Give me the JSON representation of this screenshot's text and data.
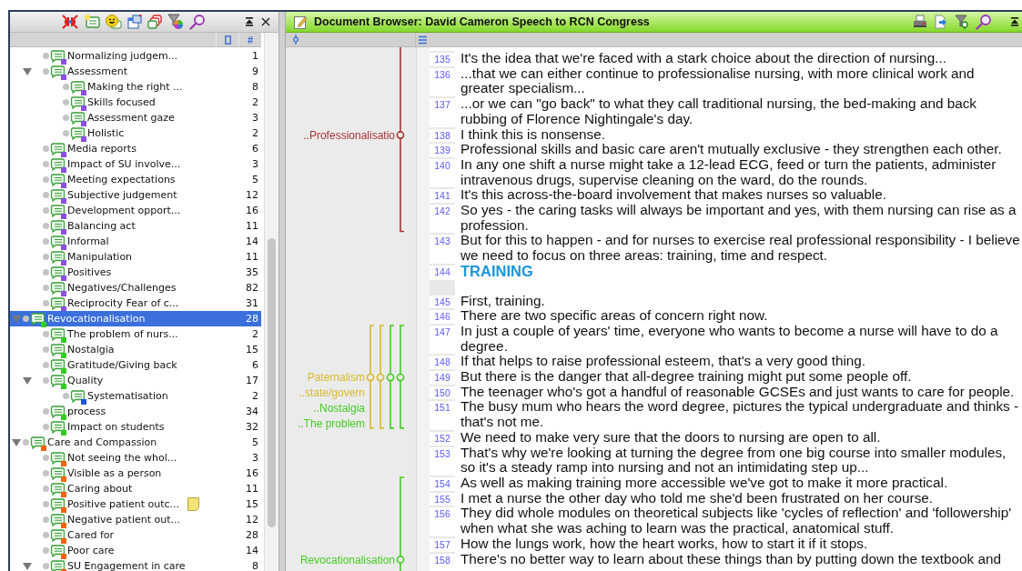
{
  "code_panel": {
    "toolbar": {
      "buttons": [
        {
          "kind": "collapse"
        },
        {
          "kind": "new-code"
        },
        {
          "kind": "smiley"
        },
        {
          "kind": "window"
        },
        {
          "kind": "windows"
        },
        {
          "kind": "color-filter"
        },
        {
          "kind": "search"
        }
      ]
    },
    "column_headers": [
      {
        "kind": "icon"
      },
      {
        "kind": "text",
        "label": "#"
      }
    ],
    "tree": {
      "scrolled_group": [
        {
          "label": "Normalizing judgem...",
          "count": "1",
          "color": "#8a4fe0",
          "selected": false,
          "expanded": false,
          "note": false
        },
        {
          "label": "Assessment",
          "count": "9",
          "color": "#8a4fe0",
          "selected": false,
          "expanded": true,
          "note": false,
          "children": [
            {
              "label": "Making the right ...",
              "count": "8",
              "color": "#8a4fe0",
              "selected": false,
              "expanded": false,
              "note": false
            },
            {
              "label": "Skills focused",
              "count": "2",
              "color": "#8a4fe0",
              "selected": false,
              "expanded": false,
              "note": false
            },
            {
              "label": "Assessment gaze",
              "count": "3",
              "color": "#8a4fe0",
              "selected": false,
              "expanded": false,
              "note": false
            },
            {
              "label": "Holistic",
              "count": "2",
              "color": "#8a4fe0",
              "selected": false,
              "expanded": false,
              "note": false
            }
          ]
        },
        {
          "label": "Media reports",
          "count": "6",
          "color": "#8a4fe0",
          "selected": false,
          "expanded": false,
          "note": false
        },
        {
          "label": "Impact of SU involve...",
          "count": "3",
          "color": "#8a4fe0",
          "selected": false,
          "expanded": false,
          "note": false
        },
        {
          "label": "Meeting expectations",
          "count": "5",
          "color": "#8a4fe0",
          "selected": false,
          "expanded": false,
          "note": false
        },
        {
          "label": "Subjective judgement",
          "count": "12",
          "color": "#8a4fe0",
          "selected": false,
          "expanded": false,
          "note": false
        },
        {
          "label": "Development opport...",
          "count": "16",
          "color": "#8a4fe0",
          "selected": false,
          "expanded": false,
          "note": false
        },
        {
          "label": "Balancing act",
          "count": "11",
          "color": "#8a4fe0",
          "selected": false,
          "expanded": false,
          "note": false
        },
        {
          "label": "Informal",
          "count": "14",
          "color": "#8a4fe0",
          "selected": false,
          "expanded": false,
          "note": false
        },
        {
          "label": "Manipulation",
          "count": "11",
          "color": "#8a4fe0",
          "selected": false,
          "expanded": false,
          "note": false
        },
        {
          "label": "Positives",
          "count": "35",
          "color": "#8a4fe0",
          "selected": false,
          "expanded": false,
          "note": false
        },
        {
          "label": "Negatives/Challenges",
          "count": "82",
          "color": "#8a4fe0",
          "selected": false,
          "expanded": false,
          "note": false
        },
        {
          "label": "Reciprocity Fear of c...",
          "count": "31",
          "color": "#8a4fe0",
          "selected": false,
          "expanded": false,
          "note": false
        }
      ],
      "items": [
        {
          "label": "Revocationalisation",
          "count": "28",
          "color": "#33cc22",
          "selected": true,
          "expanded": true,
          "note": false,
          "children": [
            {
              "label": "The problem of nurs...",
              "count": "2",
              "color": "#33cc22",
              "selected": false,
              "expanded": false,
              "note": false
            },
            {
              "label": "Nostalgia",
              "count": "15",
              "color": "#33cc22",
              "selected": false,
              "expanded": false,
              "note": false
            },
            {
              "label": "Gratitude/Giving back",
              "count": "6",
              "color": "#33cc22",
              "selected": false,
              "expanded": false,
              "note": false
            },
            {
              "label": "Quality",
              "count": "17",
              "color": "#33cc22",
              "selected": false,
              "expanded": true,
              "note": false,
              "children": [
                {
                  "label": "Systematisation",
                  "count": "2",
                  "color": "#2255dd",
                  "selected": false,
                  "expanded": false,
                  "note": false
                }
              ]
            },
            {
              "label": "process",
              "count": "34",
              "color": "#33cc22",
              "selected": false,
              "expanded": false,
              "note": false
            },
            {
              "label": "Impact on students",
              "count": "32",
              "color": "#33cc22",
              "selected": false,
              "expanded": false,
              "note": false
            }
          ]
        },
        {
          "label": "Care and Compassion",
          "count": "5",
          "color": "#ee6611",
          "selected": false,
          "expanded": true,
          "note": false,
          "children": [
            {
              "label": "Not seeing the whol...",
              "count": "3",
              "color": "#ee6611",
              "selected": false,
              "expanded": false,
              "note": false
            },
            {
              "label": "Visible as a person",
              "count": "16",
              "color": "#ee6611",
              "selected": false,
              "expanded": false,
              "note": false
            },
            {
              "label": "Caring about",
              "count": "11",
              "color": "#ee6611",
              "selected": false,
              "expanded": false,
              "note": false
            },
            {
              "label": "Positive patient outc...",
              "count": "15",
              "color": "#ee6611",
              "selected": false,
              "expanded": false,
              "note": true
            },
            {
              "label": "Negative patient out...",
              "count": "12",
              "color": "#ee6611",
              "selected": false,
              "expanded": false,
              "note": false
            },
            {
              "label": "Cared for",
              "count": "28",
              "color": "#ee6611",
              "selected": false,
              "expanded": false,
              "note": false
            },
            {
              "label": "Poor care",
              "count": "14",
              "color": "#ee6611",
              "selected": false,
              "expanded": false,
              "note": false
            },
            {
              "label": "SU Engagement in care",
              "count": "8",
              "color": "#ee6611",
              "selected": false,
              "expanded": true,
              "note": false
            }
          ]
        }
      ]
    }
  },
  "document_browser": {
    "title": "Document Browser: David Cameron Speech to RCN Congress",
    "toolbar": {
      "buttons": [
        {
          "kind": "print"
        },
        {
          "kind": "export"
        },
        {
          "kind": "filter"
        },
        {
          "kind": "search"
        }
      ]
    },
    "margin_groups": [
      {
        "codes": [
          {
            "label": "..Professionalisatio",
            "color": "#a83434"
          }
        ]
      },
      {
        "codes": [
          {
            "label": "Paternalism",
            "color": "#d8b92c"
          },
          {
            "label": "..state/govern",
            "color": "#d8b92c"
          },
          {
            "label": "..Nostalgia",
            "color": "#44cc22"
          },
          {
            "label": "..The problem",
            "color": "#44cc22"
          }
        ]
      },
      {
        "codes": [
          {
            "label": "Revocationalisation",
            "color": "#44cc22"
          }
        ]
      }
    ],
    "segments": [
      {
        "kind": "text",
        "number": "135",
        "text": "It's the idea that we're faced with a stark choice about the direction of nursing..."
      },
      {
        "kind": "text",
        "number": "136",
        "text": "...that we can either continue to professionalise nursing, with more clinical work and greater specialism..."
      },
      {
        "kind": "text",
        "number": "137",
        "text": "...or we can \"go back\" to what they call traditional nursing, the bed-making and back rubbing of Florence Nightingale's day."
      },
      {
        "kind": "text",
        "number": "138",
        "text": "I think this is nonsense."
      },
      {
        "kind": "text",
        "number": "139",
        "text": "Professional skills and basic care aren't mutually exclusive - they strengthen each other."
      },
      {
        "kind": "text",
        "number": "140",
        "text": "In any one shift a nurse might take a 12-lead ECG, feed or turn the patients, administer intravenous drugs, supervise cleaning on the ward, do the rounds."
      },
      {
        "kind": "text",
        "number": "141",
        "text": "It's this across-the-board involvement that makes nurses so valuable."
      },
      {
        "kind": "text",
        "number": "142",
        "text": "So yes - the caring tasks will always be important and yes, with them nursing can rise as a profession."
      },
      {
        "kind": "text",
        "number": "143",
        "text": "But for this to happen - and for nurses to exercise real professional responsibility - I believe we need to focus on three areas: training, time and respect."
      },
      {
        "kind": "heading",
        "number": "144",
        "text": "TRAINING"
      },
      {
        "kind": "blank"
      },
      {
        "kind": "text",
        "number": "145",
        "text": "First, training."
      },
      {
        "kind": "text",
        "number": "146",
        "text": "There are two specific areas of concern right now."
      },
      {
        "kind": "text",
        "number": "147",
        "text": "In just a couple of years' time, everyone who wants to become a nurse will have to do a degree."
      },
      {
        "kind": "text",
        "number": "148",
        "text": "If that helps to raise professional esteem, that's a very good thing."
      },
      {
        "kind": "text",
        "number": "149",
        "text": "But there is the danger that all-degree training might put some people off."
      },
      {
        "kind": "text",
        "number": "150",
        "text": "The teenager who's got a handful of reasonable GCSEs and just wants to care for people."
      },
      {
        "kind": "text",
        "number": "151",
        "text": "The busy mum who hears the word degree, pictures the typical undergraduate and thinks - that's not me."
      },
      {
        "kind": "text",
        "number": "152",
        "text": "We need to make very sure that the doors to nursing are open to all."
      },
      {
        "kind": "text",
        "number": "153",
        "text": "That's why we're looking at turning the degree from one big course into smaller modules, so it's a steady ramp into nursing and not an intimidating step up..."
      },
      {
        "kind": "text",
        "number": "154",
        "text": "As well as making training more accessible we've got to make it more practical."
      },
      {
        "kind": "text",
        "number": "155",
        "text": "I met a nurse the other day who told me she'd been frustrated on her course."
      },
      {
        "kind": "text",
        "number": "156",
        "text": "They did whole modules on theoretical subjects like 'cycles of reflection' and 'followership' when what she was aching to learn was the practical, anatomical stuff."
      },
      {
        "kind": "text",
        "number": "157",
        "text": "How the lungs work, how the heart works, how to start it if it stops."
      },
      {
        "kind": "text",
        "number": "158",
        "text": "There's no better way to learn about these things than by putting down the textbook and"
      }
    ]
  }
}
